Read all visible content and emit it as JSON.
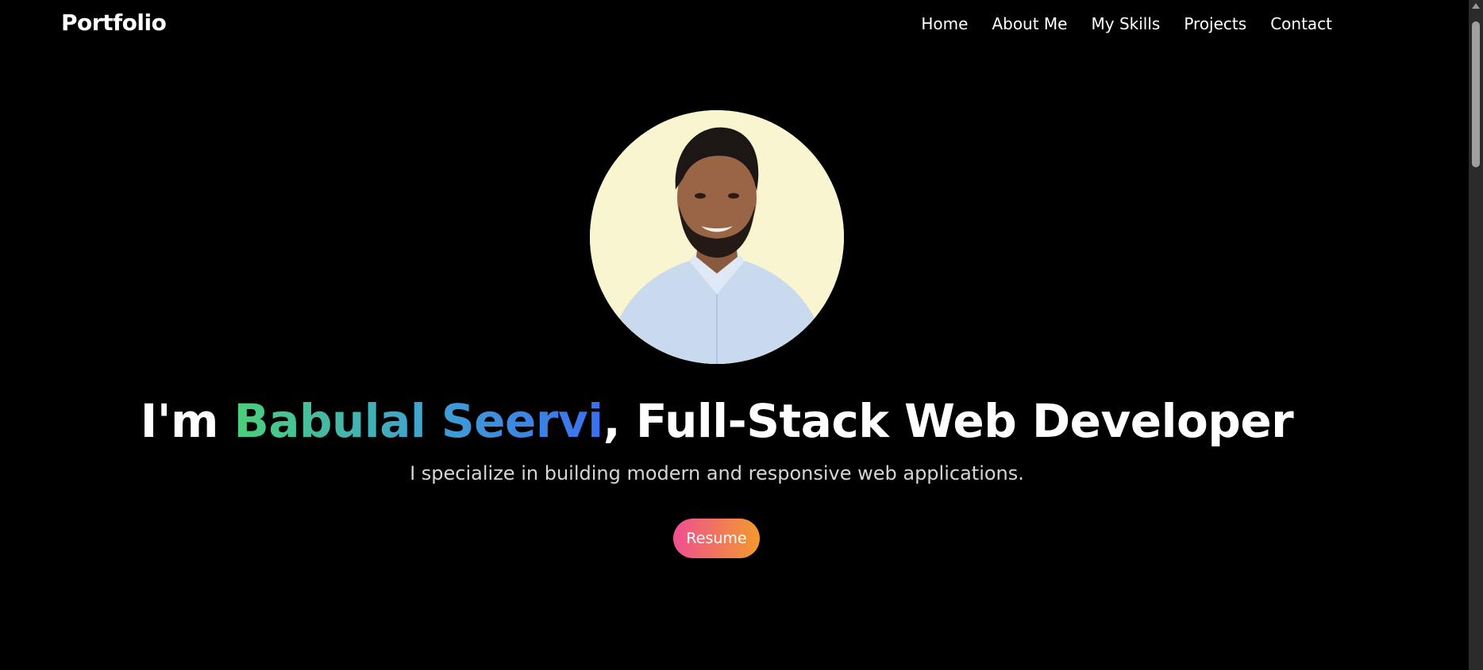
{
  "nav": {
    "brand": "Portfolio",
    "links": [
      "Home",
      "About Me",
      "My Skills",
      "Projects",
      "Contact"
    ]
  },
  "hero": {
    "headline_prefix": "I'm ",
    "headline_name": "Babulal Seervi",
    "headline_suffix": ", Full-Stack Web Developer",
    "subtitle": "I specialize in building modern and responsive web applications.",
    "resume_label": "Resume"
  },
  "colors": {
    "background": "#000000",
    "name_gradient": [
      "#4ad07a",
      "#3b6ff0"
    ],
    "button_gradient": [
      "#ef4f92",
      "#f39a2d"
    ]
  },
  "icons": {
    "avatar": "profile-photo"
  }
}
